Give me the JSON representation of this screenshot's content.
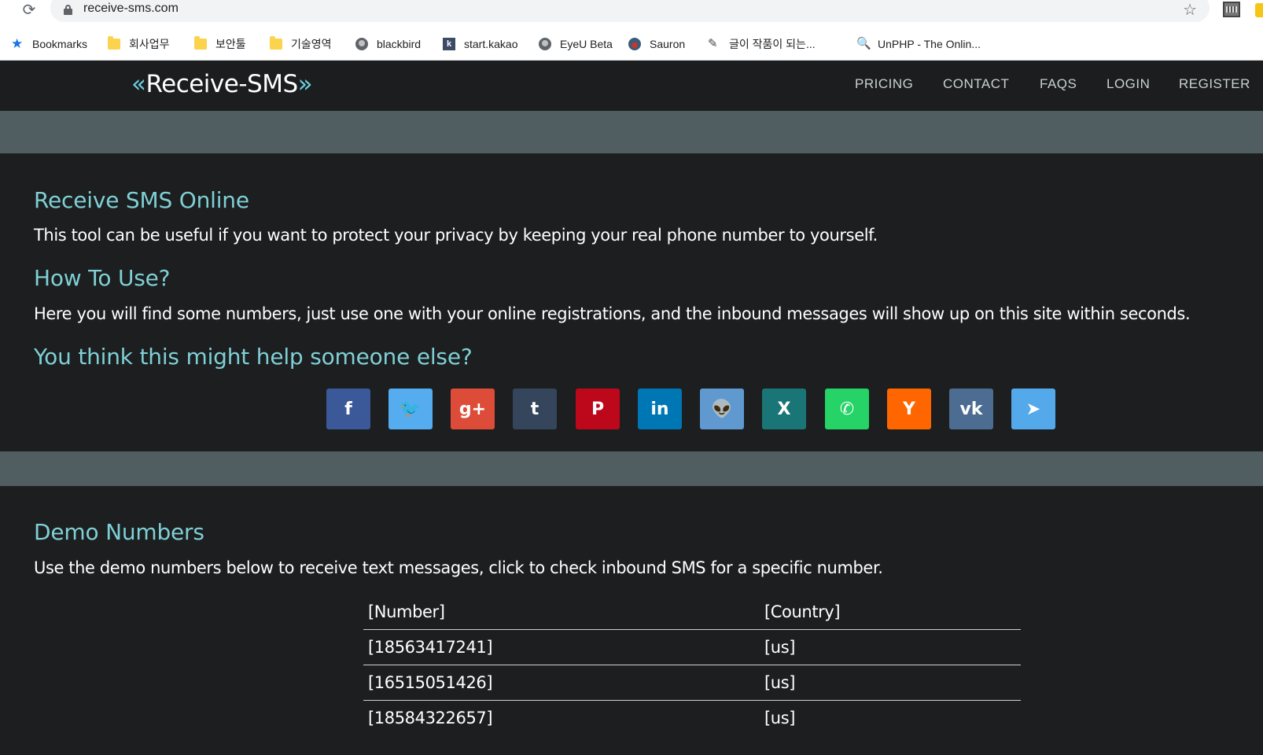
{
  "browser": {
    "url": "receive-sms.com",
    "bookmarks": [
      {
        "label": "Bookmarks",
        "icon": "star-icon"
      },
      {
        "label": "회사업무",
        "icon": "folder-icon"
      },
      {
        "label": "보안툴",
        "icon": "folder-icon"
      },
      {
        "label": "기술영역",
        "icon": "folder-icon"
      },
      {
        "label": "blackbird",
        "icon": "globe-icon"
      },
      {
        "label": "start.kakao",
        "icon": "kakao-icon",
        "glyph": "k"
      },
      {
        "label": "EyeU Beta",
        "icon": "globe-icon"
      },
      {
        "label": "Sauron",
        "icon": "sauron-icon"
      },
      {
        "label": "글이 작품이 되는...",
        "icon": "pen-icon"
      },
      {
        "label": "UnPHP - The Onlin...",
        "icon": "search-icon"
      }
    ]
  },
  "site": {
    "logo": {
      "left_quote": "«",
      "name": "Receive-SMS",
      "right_quote": "»"
    },
    "nav": [
      "PRICING",
      "CONTACT",
      "FAQS",
      "LOGIN",
      "REGISTER"
    ]
  },
  "intro": {
    "heading": "Receive SMS Online",
    "text": "This tool can be useful if you want to protect your privacy by keeping your real phone number to yourself.",
    "howto_heading": "How To Use?",
    "howto_text": "Here you will find some numbers, just use one with your online registrations, and the inbound messages will show up on this site within seconds.",
    "share_heading": "You think this might help someone else?"
  },
  "share_buttons": [
    {
      "icon": "facebook-icon",
      "glyph": "f",
      "color": "#3b5998"
    },
    {
      "icon": "twitter-icon",
      "glyph": "🐦",
      "color": "#55acee"
    },
    {
      "icon": "google-plus-icon",
      "glyph": "g+",
      "color": "#dd4b39"
    },
    {
      "icon": "tumblr-icon",
      "glyph": "t",
      "color": "#35465c"
    },
    {
      "icon": "pinterest-icon",
      "glyph": "P",
      "color": "#bd081c"
    },
    {
      "icon": "linkedin-icon",
      "glyph": "in",
      "color": "#0077b5"
    },
    {
      "icon": "reddit-icon",
      "glyph": "👽",
      "color": "#5f99cf"
    },
    {
      "icon": "xing-icon",
      "glyph": "X",
      "color": "#1a7576"
    },
    {
      "icon": "whatsapp-icon",
      "glyph": "✆",
      "color": "#25d366"
    },
    {
      "icon": "hacker-news-icon",
      "glyph": "Y",
      "color": "#ff6600"
    },
    {
      "icon": "vk-icon",
      "glyph": "vk",
      "color": "#4c6c91"
    },
    {
      "icon": "telegram-icon",
      "glyph": "➤",
      "color": "#54a9eb"
    }
  ],
  "demo": {
    "heading": "Demo Numbers",
    "text": "Use the demo numbers below to receive text messages, click to check inbound SMS for a specific number.",
    "columns": [
      "[Number]",
      "[Country]"
    ],
    "rows": [
      [
        "[18563417241]",
        "[us]"
      ],
      [
        "[16515051426]",
        "[us]"
      ],
      [
        "[18584322657]",
        "[us]"
      ]
    ]
  }
}
